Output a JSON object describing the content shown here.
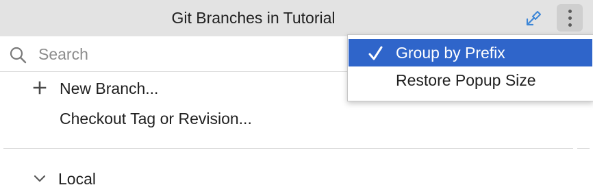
{
  "popup": {
    "title": "Git Branches in Tutorial"
  },
  "search": {
    "placeholder": "Search",
    "value": ""
  },
  "actions": [
    {
      "label": "New Branch...",
      "icon": "plus-icon"
    },
    {
      "label": "Checkout Tag or Revision..."
    }
  ],
  "groups": [
    {
      "label": "Local",
      "icon": "chevron-down-icon",
      "expanded": true
    }
  ],
  "menu": {
    "items": [
      {
        "label": "Group by Prefix",
        "checked": true,
        "highlighted": true
      },
      {
        "label": "Restore Popup Size",
        "checked": false,
        "highlighted": false
      }
    ]
  },
  "colors": {
    "titlebar": "#e3e3e3",
    "selection": "#2f65ca",
    "pin_icon": "#3d86d6"
  }
}
